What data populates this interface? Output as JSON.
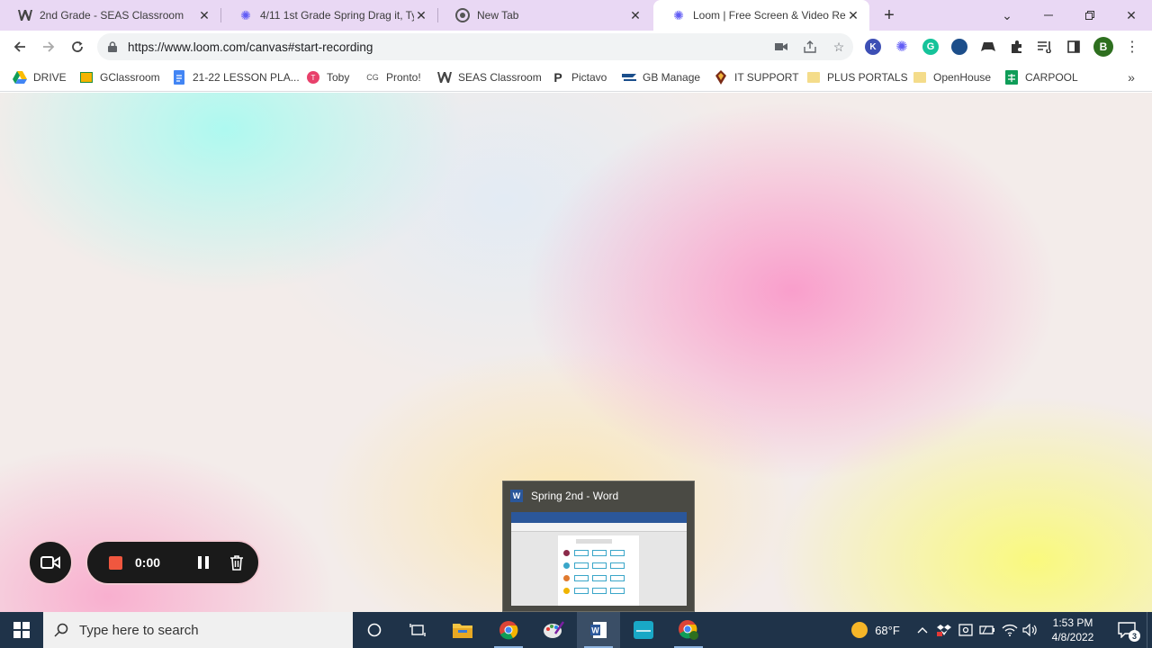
{
  "browser": {
    "tabs": [
      {
        "label": "2nd Grade - SEAS Classroom",
        "icon": "w-logo-icon",
        "active": false
      },
      {
        "label": "4/11 1st Grade Spring Drag it, Ty",
        "icon": "loom-icon",
        "active": false
      },
      {
        "label": "New Tab",
        "icon": "chrome-icon",
        "active": false
      },
      {
        "label": "Loom | Free Screen & Video Reco",
        "icon": "loom-icon",
        "active": true
      }
    ],
    "url": "https://www.loom.com/canvas#start-recording",
    "profile_initial": "B",
    "bookmarks": [
      {
        "label": "DRIVE",
        "icon": "drive-icon"
      },
      {
        "label": "GClassroom",
        "icon": "classroom-icon"
      },
      {
        "label": "21-22 LESSON PLA...",
        "icon": "docs-icon"
      },
      {
        "label": "Toby",
        "icon": "toby-icon"
      },
      {
        "label": "Pronto!",
        "icon": "pronto-icon"
      },
      {
        "label": "SEAS Classroom",
        "icon": "w-logo-icon"
      },
      {
        "label": "Pictavo",
        "icon": "pictavo-icon"
      },
      {
        "label": "GB Manage",
        "icon": "gb-icon"
      },
      {
        "label": "IT SUPPORT",
        "icon": "it-icon"
      },
      {
        "label": "PLUS PORTALS",
        "icon": "folder-icon"
      },
      {
        "label": "OpenHouse",
        "icon": "folder-icon"
      },
      {
        "label": "CARPOOL",
        "icon": "sheets-icon"
      }
    ],
    "bookmarks_more": "»"
  },
  "loom": {
    "timer": "0:00"
  },
  "preview": {
    "title": "Spring 2nd - Word",
    "app_badge": "W"
  },
  "taskbar": {
    "search_placeholder": "Type here to search",
    "weather": "68°F",
    "time": "1:53 PM",
    "date": "4/8/2022",
    "notification_count": "3"
  },
  "colors": {
    "tabstrip": "#e9d8f4",
    "record_red": "#f0573f",
    "taskbar": "#1f3349"
  }
}
